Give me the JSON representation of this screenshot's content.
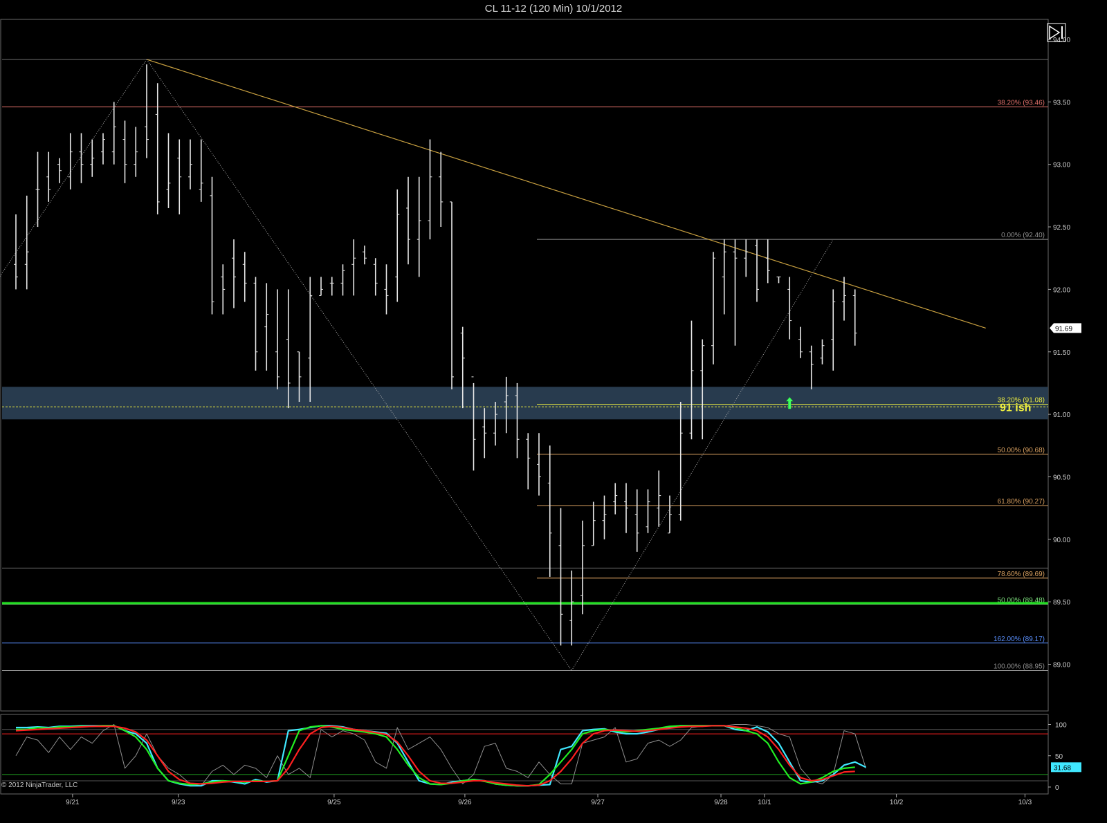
{
  "title": "CL 11-12 (120 Min)  10/1/2012",
  "copyright": "© 2012 NinjaTrader, LLC",
  "annotation": "91 ish",
  "last_price_label": "91.69",
  "stoch_last_label": "31.68",
  "icons": {
    "playback": "skip-forward-icon",
    "signal": "up-arrow-icon"
  },
  "colors": {
    "background": "#000000",
    "bars": "#e8e8e8",
    "trendline": "#c8a040",
    "zone": "#2a3e52",
    "green_level": "#22dd22",
    "fib_orange": "#d8a060",
    "fib_red": "#e0706a",
    "fib_yellow": "#e8e840",
    "fib_blue": "#5a90ff",
    "stoch_k": "#ff2020",
    "stoch_d": "#22ee22",
    "stoch_raw": "#909090",
    "stoch_cyan": "#40e8ff"
  },
  "chart_data": [
    {
      "type": "ohlc",
      "title": "CL 11-12 (120 Min)  10/1/2012",
      "x_tick_labels": [
        "9/21",
        "9/23",
        "9/25",
        "9/26",
        "9/27",
        "9/28",
        "10/1",
        "10/2",
        "10/3"
      ],
      "y_tick_labels": [
        "94.00",
        "93.50",
        "93.00",
        "92.50",
        "92.00",
        "91.50",
        "91.00",
        "90.50",
        "90.00",
        "89.50",
        "89.00"
      ],
      "ylim": [
        88.65,
        94.2
      ],
      "bars": [
        [
          92.2,
          92.6,
          92.0,
          92.1
        ],
        [
          92.2,
          92.75,
          92.0,
          92.3
        ],
        [
          92.8,
          93.1,
          92.5,
          92.8
        ],
        [
          92.9,
          93.1,
          92.7,
          92.8
        ],
        [
          93.0,
          93.05,
          92.85,
          92.95
        ],
        [
          92.9,
          93.25,
          92.8,
          93.1
        ],
        [
          93.1,
          93.25,
          92.85,
          93.0
        ],
        [
          93.0,
          93.2,
          92.9,
          93.05
        ],
        [
          93.1,
          93.25,
          93.0,
          93.2
        ],
        [
          93.1,
          93.5,
          93.0,
          93.3
        ],
        [
          93.2,
          93.35,
          92.85,
          93.0
        ],
        [
          93.0,
          93.3,
          92.9,
          93.1
        ],
        [
          93.3,
          93.8,
          93.05,
          93.2
        ],
        [
          93.4,
          93.65,
          92.6,
          92.7
        ],
        [
          92.8,
          93.25,
          92.65,
          92.85
        ],
        [
          93.05,
          93.2,
          92.6,
          92.9
        ],
        [
          92.9,
          93.2,
          92.8,
          93.0
        ],
        [
          92.8,
          93.2,
          92.7,
          92.85
        ],
        [
          92.75,
          92.9,
          91.8,
          91.9
        ],
        [
          92.1,
          92.2,
          91.8,
          92.0
        ],
        [
          92.25,
          92.4,
          91.85,
          92.1
        ],
        [
          92.2,
          92.3,
          91.9,
          92.05
        ],
        [
          92.05,
          92.1,
          91.35,
          91.5
        ],
        [
          91.7,
          92.05,
          91.35,
          91.8
        ],
        [
          91.5,
          92.0,
          91.2,
          91.3
        ],
        [
          91.6,
          92.0,
          91.05,
          91.25
        ],
        [
          91.5,
          91.5,
          91.1,
          91.3
        ],
        [
          91.45,
          92.1,
          91.1,
          91.95
        ],
        [
          91.95,
          92.1,
          91.95,
          92.0
        ],
        [
          92.05,
          92.1,
          91.95,
          92.05
        ],
        [
          92.05,
          92.2,
          91.95,
          92.15
        ],
        [
          92.2,
          92.4,
          91.95,
          92.25
        ],
        [
          92.3,
          92.35,
          92.2,
          92.25
        ],
        [
          92.2,
          92.25,
          91.95,
          92.05
        ],
        [
          92.0,
          92.2,
          91.8,
          91.95
        ],
        [
          92.1,
          92.8,
          91.9,
          92.6
        ],
        [
          92.65,
          92.9,
          92.2,
          92.4
        ],
        [
          92.4,
          92.9,
          92.1,
          92.55
        ],
        [
          92.55,
          93.2,
          92.4,
          92.9
        ],
        [
          92.9,
          93.1,
          92.5,
          92.7
        ],
        [
          92.7,
          92.7,
          91.2,
          91.3
        ],
        [
          91.65,
          91.7,
          91.05,
          91.45
        ],
        [
          91.3,
          91.25,
          90.55,
          90.8
        ],
        [
          90.9,
          91.05,
          90.65,
          90.85
        ],
        [
          90.85,
          91.1,
          90.75,
          91.0
        ],
        [
          91.1,
          91.3,
          90.85,
          91.15
        ],
        [
          91.15,
          91.25,
          90.65,
          90.8
        ],
        [
          90.8,
          90.85,
          90.4,
          90.65
        ],
        [
          90.6,
          90.85,
          90.35,
          90.5
        ],
        [
          90.45,
          90.75,
          89.7,
          90.05
        ],
        [
          89.95,
          90.25,
          89.15,
          89.4
        ],
        [
          89.35,
          89.75,
          89.15,
          89.5
        ],
        [
          89.55,
          90.15,
          89.4,
          89.95
        ],
        [
          89.95,
          90.3,
          89.95,
          90.15
        ],
        [
          90.15,
          90.35,
          90.0,
          90.2
        ],
        [
          90.3,
          90.45,
          90.2,
          90.35
        ],
        [
          90.3,
          90.45,
          90.05,
          90.25
        ],
        [
          90.2,
          90.4,
          89.9,
          90.05
        ],
        [
          90.1,
          90.4,
          90.05,
          90.3
        ],
        [
          90.25,
          90.55,
          90.1,
          90.35
        ],
        [
          90.05,
          90.35,
          90.05,
          90.2
        ],
        [
          90.2,
          91.1,
          90.15,
          90.85
        ],
        [
          90.85,
          91.75,
          90.8,
          91.35
        ],
        [
          91.35,
          91.6,
          90.8,
          91.55
        ],
        [
          91.55,
          92.3,
          91.4,
          92.25
        ],
        [
          92.1,
          92.4,
          91.8,
          92.3
        ],
        [
          92.3,
          92.4,
          91.55,
          92.25
        ],
        [
          92.25,
          92.4,
          92.1,
          92.3
        ],
        [
          92.35,
          92.4,
          91.9,
          92.0
        ],
        [
          92.25,
          92.4,
          92.05,
          92.15
        ],
        [
          92.1,
          92.1,
          92.05,
          92.1
        ],
        [
          92.0,
          92.1,
          91.6,
          91.75
        ],
        [
          91.6,
          91.7,
          91.45,
          91.5
        ],
        [
          91.5,
          91.55,
          91.2,
          91.4
        ],
        [
          91.45,
          91.6,
          91.4,
          91.55
        ],
        [
          91.6,
          92.0,
          91.35,
          91.9
        ],
        [
          91.9,
          92.1,
          91.75,
          91.95
        ],
        [
          91.95,
          92.0,
          91.55,
          91.65
        ]
      ],
      "trendlines": [
        {
          "from": [
            12,
            93.84
          ],
          "to": [
            89,
            91.69
          ]
        },
        {
          "from": [
            -5,
            91.65
          ],
          "to": [
            12,
            93.84
          ]
        },
        {
          "from": [
            12,
            93.84
          ],
          "to": [
            51,
            88.95
          ]
        },
        {
          "from": [
            51,
            88.95
          ],
          "to": [
            75,
            92.4
          ]
        }
      ],
      "levels": [
        {
          "label": "38.20% (93.46)",
          "value": 93.46,
          "color": "#e0706a",
          "extent": "full"
        },
        {
          "label": "0.00% (92.40)",
          "value": 92.4,
          "color": "#909090",
          "extent": "right"
        },
        {
          "label": "38.20% (91.08)",
          "value": 91.08,
          "color": "#e8e840",
          "extent": "right"
        },
        {
          "label": "50.00% (90.68)",
          "value": 90.68,
          "color": "#d8a060",
          "extent": "right"
        },
        {
          "label": "61.80% (90.27)",
          "value": 90.27,
          "color": "#d8a060",
          "extent": "right"
        },
        {
          "label": "78.60% (89.69)",
          "value": 89.69,
          "color": "#d8a060",
          "extent": "right"
        },
        {
          "label": "50.00% (89.48)",
          "value": 89.48,
          "color": "#7ee07e",
          "extent": "full"
        },
        {
          "label": "162.00% (89.17)",
          "value": 89.17,
          "color": "#5a90ff",
          "extent": "full"
        },
        {
          "label": "100.00% (88.95)",
          "value": 88.95,
          "color": "#909090",
          "extent": "full"
        }
      ],
      "gray_lines": [
        93.84,
        89.77
      ],
      "green_level": 89.49,
      "zone": [
        90.96,
        91.22
      ],
      "dashed_level": 91.06,
      "last_price": 91.69,
      "signal_bar": 71
    },
    {
      "type": "line",
      "name": "stochastics",
      "y_tick_labels": [
        "100",
        "50",
        "0"
      ],
      "ylim": [
        -5,
        107
      ],
      "levels": [
        85,
        20
      ],
      "last_value": 31.68,
      "series": [
        {
          "name": "",
          "color": "#909090",
          "values": [
            50,
            80,
            75,
            55,
            80,
            60,
            80,
            70,
            90,
            100,
            30,
            50,
            85,
            50,
            30,
            20,
            5,
            2,
            25,
            35,
            20,
            35,
            30,
            15,
            50,
            20,
            30,
            15,
            92,
            80,
            90,
            85,
            75,
            40,
            30,
            95,
            60,
            70,
            80,
            60,
            30,
            5,
            20,
            65,
            70,
            30,
            25,
            15,
            40,
            20,
            5,
            5,
            70,
            75,
            80,
            95,
            40,
            45,
            70,
            75,
            65,
            75,
            95,
            97,
            98,
            98,
            100,
            100,
            98,
            95,
            85,
            80,
            30,
            10,
            5,
            20,
            90,
            85,
            30
          ]
        },
        {
          "name": "",
          "color": "#40e8ff",
          "values": [
            95,
            95,
            96,
            95,
            97,
            97,
            98,
            98,
            98,
            98,
            90,
            85,
            70,
            30,
            10,
            5,
            2,
            2,
            10,
            10,
            8,
            5,
            12,
            8,
            10,
            90,
            92,
            95,
            98,
            98,
            96,
            92,
            90,
            88,
            86,
            70,
            40,
            10,
            5,
            4,
            8,
            10,
            12,
            10,
            5,
            3,
            2,
            2,
            3,
            4,
            60,
            65,
            90,
            92,
            93,
            88,
            85,
            85,
            88,
            92,
            96,
            98,
            98,
            98,
            98,
            98,
            92,
            90,
            96,
            88,
            70,
            40,
            10,
            8,
            10,
            20,
            35,
            40,
            31.68
          ]
        },
        {
          "name": "",
          "color": "#22ee22",
          "values": [
            92,
            92,
            95,
            94,
            96,
            96,
            97,
            97,
            98,
            98,
            90,
            80,
            60,
            30,
            10,
            6,
            4,
            5,
            8,
            10,
            9,
            8,
            10,
            9,
            10,
            50,
            90,
            96,
            98,
            96,
            92,
            90,
            88,
            85,
            80,
            60,
            35,
            15,
            5,
            4,
            6,
            10,
            12,
            9,
            5,
            3,
            2,
            2,
            4,
            20,
            40,
            60,
            85,
            90,
            92,
            90,
            88,
            90,
            92,
            94,
            97,
            98,
            98,
            98,
            98,
            98,
            95,
            90,
            85,
            70,
            40,
            15,
            5,
            8,
            15,
            25,
            30,
            31.68
          ]
        },
        {
          "name": "",
          "color": "#ff2020",
          "values": [
            90,
            91,
            92,
            93,
            94,
            95,
            96,
            97,
            97,
            97,
            94,
            88,
            75,
            50,
            25,
            12,
            6,
            5,
            6,
            8,
            9,
            9,
            9,
            9,
            10,
            30,
            60,
            85,
            95,
            97,
            95,
            92,
            90,
            87,
            84,
            72,
            50,
            25,
            10,
            6,
            6,
            8,
            10,
            10,
            7,
            5,
            3,
            2,
            3,
            10,
            25,
            45,
            70,
            85,
            90,
            91,
            90,
            89,
            90,
            92,
            94,
            96,
            97,
            97,
            98,
            98,
            96,
            94,
            90,
            80,
            60,
            35,
            15,
            10,
            12,
            18,
            24,
            25
          ]
        }
      ]
    }
  ]
}
